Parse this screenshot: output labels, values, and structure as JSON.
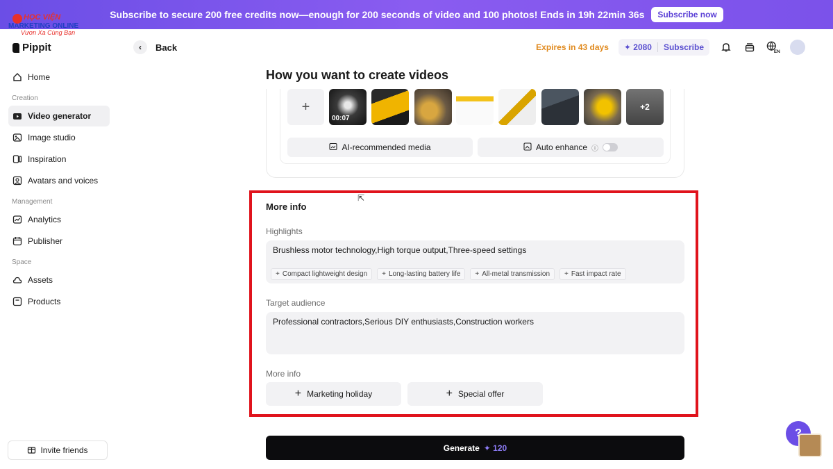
{
  "promo": {
    "text": "Subscribe to secure 200 free credits now—enough for 200 seconds of video and 100 photos! Ends in 19h 22min 36s",
    "button": "Subscribe now"
  },
  "watermark": {
    "line1": "HỌC VIỆN",
    "line2": "MARKETING ONLINE",
    "line3": "Vươn Xa Cùng Bạn"
  },
  "logo": {
    "name": "Pippit"
  },
  "sidebar": {
    "items_top": [
      {
        "label": "Home",
        "icon": "home-icon"
      }
    ],
    "creation_label": "Creation",
    "creation": [
      {
        "label": "Video generator",
        "icon": "video-generator-icon",
        "active": true
      },
      {
        "label": "Image studio",
        "icon": "image-icon"
      },
      {
        "label": "Inspiration",
        "icon": "inspiration-icon"
      },
      {
        "label": "Avatars and voices",
        "icon": "avatar-icon"
      }
    ],
    "management_label": "Management",
    "management": [
      {
        "label": "Analytics",
        "icon": "analytics-icon"
      },
      {
        "label": "Publisher",
        "icon": "calendar-icon"
      }
    ],
    "space_label": "Space",
    "space": [
      {
        "label": "Assets",
        "icon": "cloud-icon"
      },
      {
        "label": "Products",
        "icon": "products-icon"
      }
    ],
    "invite": "Invite friends"
  },
  "header": {
    "back": "Back",
    "expires": "Expires in 43 days",
    "credits": "✦ 2080",
    "subscribe": "Subscribe",
    "lang": "EN"
  },
  "main": {
    "title": "How you want to create videos",
    "thumbnail_duration": "00:07",
    "more_count": "+2",
    "ai_media": "AI-recommended media",
    "auto_enhance": "Auto enhance",
    "auto_enhance_on": false,
    "more_info_title": "More info",
    "highlights_label": "Highlights",
    "highlights_value": "Brushless motor technology,High torque output,Three-speed settings",
    "chips": [
      "Compact lightweight design",
      "Long-lasting battery life",
      "All-metal transmission",
      "Fast impact rate"
    ],
    "target_label": "Target audience",
    "target_value": "Professional contractors,Serious DIY enthusiasts,Construction workers",
    "more_info_label": "More info",
    "marketing_holiday": "Marketing holiday",
    "special_offer": "Special offer",
    "generate": "Generate",
    "generate_cost": "✦ 120"
  },
  "colors": {
    "accent": "#6b4ee6",
    "highlight_border": "#e0131c",
    "expires": "#e08a1e"
  }
}
